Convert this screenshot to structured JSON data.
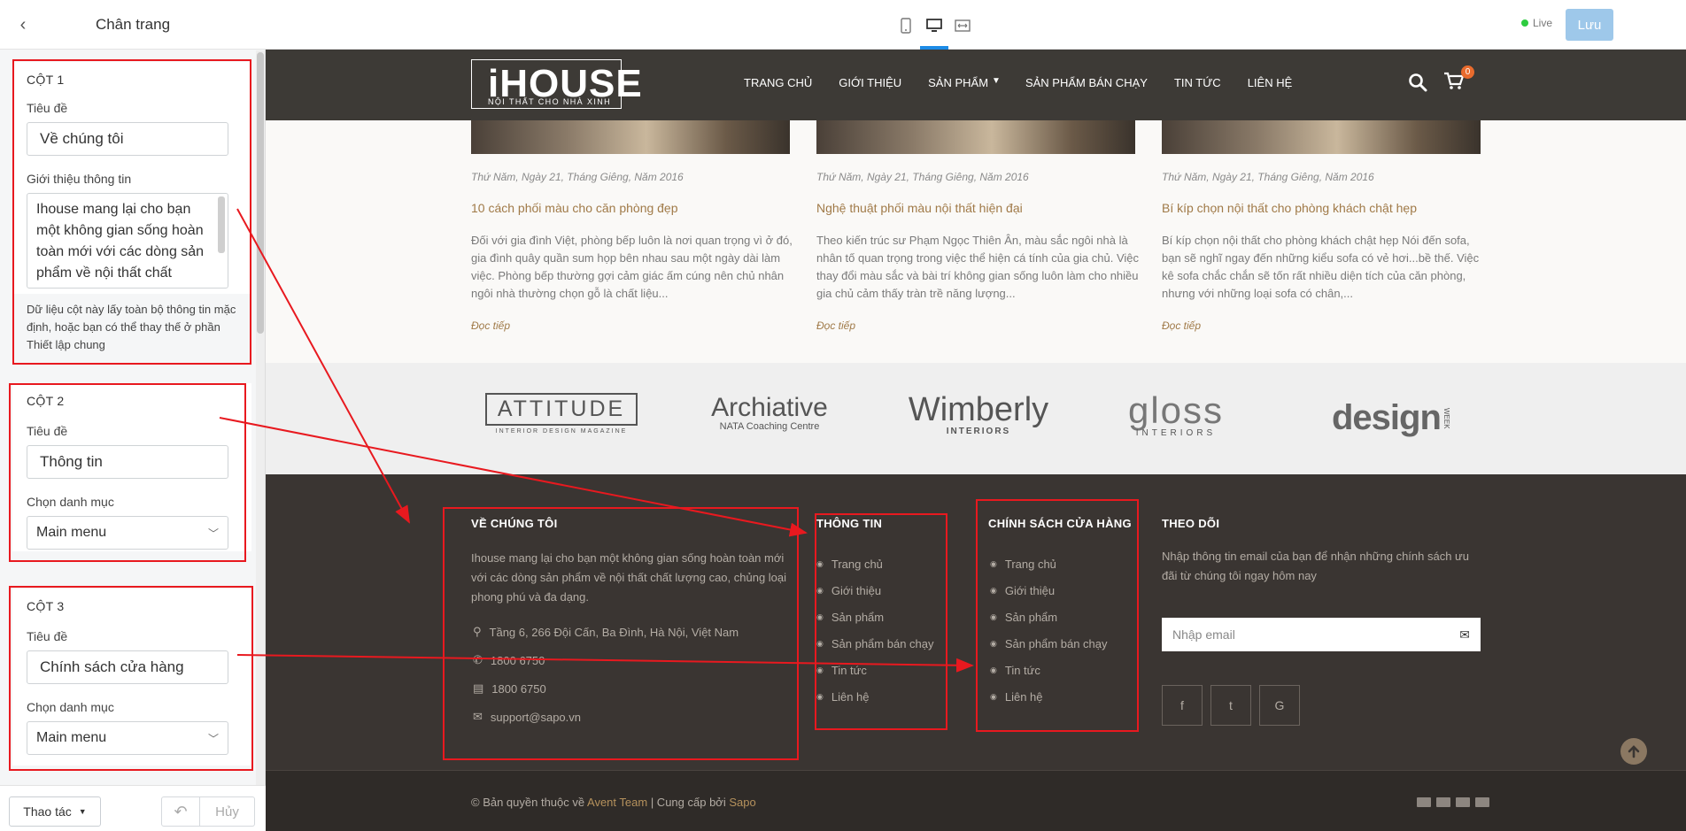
{
  "panel": {
    "title": "Chân trang",
    "col1": {
      "heading": "CỘT 1",
      "title_label": "Tiêu đề",
      "title_value": "Về chúng tôi",
      "info_label": "Giới thiệu thông tin",
      "info_value": "Ihouse mang lại cho bạn một không gian sống hoàn toàn mới với các dòng sản phẩm về nội thất chất",
      "note": "Dữ liệu cột này lấy toàn bộ thông tin mặc định, hoặc bạn có thể thay thế ở phần Thiết lập chung"
    },
    "col2": {
      "heading": "CỘT 2",
      "title_label": "Tiêu đề",
      "title_value": "Thông tin",
      "menu_label": "Chọn danh mục",
      "menu_value": "Main menu"
    },
    "col3": {
      "heading": "CỘT 3",
      "title_label": "Tiêu đề",
      "title_value": "Chính sách cửa hàng",
      "menu_label": "Chọn danh mục",
      "menu_value": "Main menu"
    },
    "footer": {
      "actions_label": "Thao tác",
      "cancel_label": "Hủy"
    }
  },
  "toolbar": {
    "live_label": "Live",
    "save_label": "Lưu"
  },
  "site": {
    "logo_big": "iHOUSE",
    "logo_small": "NỘI THẤT CHO NHÀ XINH",
    "nav": [
      "TRANG CHỦ",
      "GIỚI THIỆU",
      "SẢN PHẨM",
      "SẢN PHẨM BÁN CHẠY",
      "TIN TỨC",
      "LIÊN HỆ"
    ],
    "cart_count": "0",
    "posts": [
      {
        "date": "Thứ Năm, Ngày 21, Tháng Giêng, Năm 2016",
        "title": "10 cách phối màu cho căn phòng đẹp",
        "excerpt": "Đối với gia đình Việt, phòng bếp luôn là nơi quan trọng vì ở đó, gia đình quây quần sum họp bên nhau sau một ngày dài làm việc. Phòng bếp thường gợi cảm giác ấm cúng nên chủ nhân ngôi nhà thường chọn gỗ là chất liệu...",
        "more": "Đọc tiếp"
      },
      {
        "date": "Thứ Năm, Ngày 21, Tháng Giêng, Năm 2016",
        "title": "Nghệ thuật phối màu nội thất hiện đại",
        "excerpt": "Theo kiến trúc sư Phạm Ngọc Thiên Ân, màu sắc ngôi nhà là nhân tố quan trọng trong việc thể hiện cá tính của gia chủ. Việc thay đổi màu sắc và bài trí không gian sống luôn làm cho nhiều gia chủ cảm thấy tràn trề năng lượng...",
        "more": "Đọc tiếp"
      },
      {
        "date": "Thứ Năm, Ngày 21, Tháng Giêng, Năm 2016",
        "title": "Bí kíp chọn nội thất cho phòng khách chật hẹp",
        "excerpt": "Bí kíp chọn nội thất cho phòng khách chật hẹp Nói đến sofa, bạn sẽ nghĩ ngay đến những kiểu sofa có vẻ hơi...bề thế. Việc kê sofa chắc chắn sẽ tốn rất nhiều diện tích của căn phòng, nhưng với những loại sofa có chân,...",
        "more": "Đọc tiếp"
      }
    ],
    "brands": [
      {
        "name": "ATTITUDE",
        "sub": "INTERIOR DESIGN MAGAZINE"
      },
      {
        "name": "Archiative",
        "sub": "NATA Coaching Centre"
      },
      {
        "name": "Wimberly",
        "sub": "INTERIORS"
      },
      {
        "name": "gloss",
        "sub": "INTERIORS"
      },
      {
        "name": "design",
        "sub": "WEEK"
      }
    ],
    "footer": {
      "about_title": "VỀ CHÚNG TÔI",
      "about_text": "Ihouse mang lại cho bạn một không gian sống hoàn toàn mới với các dòng sản phẩm về nội thất chất lượng cao, chủng loại phong phú và đa dạng.",
      "address": "Tầng 6, 266 Đội Cấn, Ba Đình, Hà Nội, Việt Nam",
      "phone": "1800 6750",
      "fax": "1800 6750",
      "email": "support@sapo.vn",
      "info_title": "THÔNG TIN",
      "policy_title": "CHÍNH SÁCH CỬA HÀNG",
      "links": [
        "Trang chủ",
        "Giới thiệu",
        "Sản phẩm",
        "Sản phẩm bán chạy",
        "Tin tức",
        "Liên hệ"
      ],
      "follow_title": "THEO DÕI",
      "follow_text": "Nhập thông tin email của bạn để nhận những chính sách ưu đãi từ chúng tôi ngay hôm nay",
      "email_placeholder": "Nhập email",
      "social": [
        "f",
        "t",
        "G"
      ],
      "copyright_prefix": "© Bản quyền thuộc về ",
      "copyright_team": "Avent Team",
      "copyright_mid": " | Cung cấp bởi ",
      "copyright_brand": "Sapo"
    }
  },
  "colors": {
    "annotation": "#e8191f",
    "accent": "#1d8be6",
    "gold": "#a07a48",
    "footer_bg": "#3a3532"
  }
}
